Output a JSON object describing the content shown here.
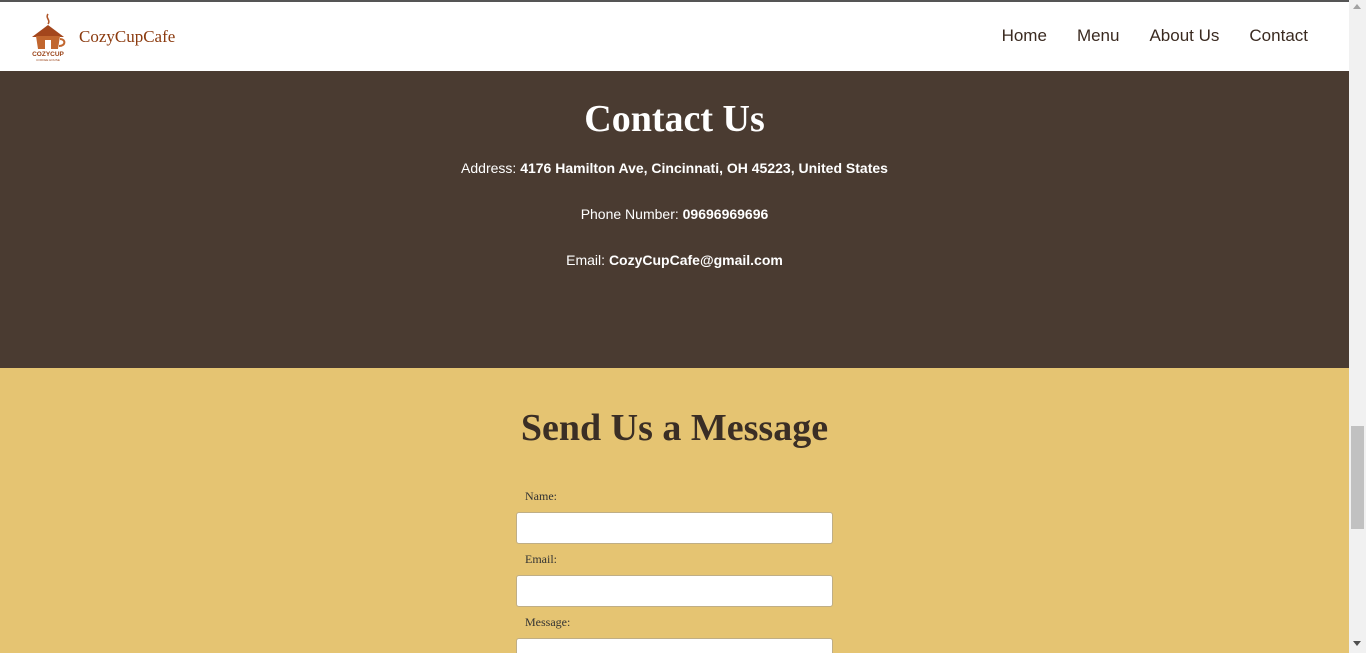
{
  "brand": {
    "name": "CozyCupCafe",
    "logo_text": "COZYCUP",
    "logo_subtext": "COFFEE HOUSE"
  },
  "nav": {
    "items": [
      {
        "label": "Home"
      },
      {
        "label": "Menu"
      },
      {
        "label": "About Us"
      },
      {
        "label": "Contact"
      }
    ]
  },
  "contact": {
    "title": "Contact Us",
    "address_label": "Address:",
    "address_value": "4176 Hamilton Ave, Cincinnati, OH 45223, United States",
    "phone_label": "Phone Number:",
    "phone_value": "09696969696",
    "email_label": "Email:",
    "email_value": "CozyCupCafe@gmail.com"
  },
  "message_form": {
    "title": "Send Us a Message",
    "name_label": "Name:",
    "name_value": "",
    "email_label": "Email:",
    "email_value": "",
    "message_label": "Message:",
    "message_value": ""
  },
  "colors": {
    "header_bg": "#ffffff",
    "brand_text": "#8b3a0e",
    "contact_bg": "#4a3b31",
    "message_bg": "#e5c472",
    "heading_dark": "#3a2e25"
  }
}
